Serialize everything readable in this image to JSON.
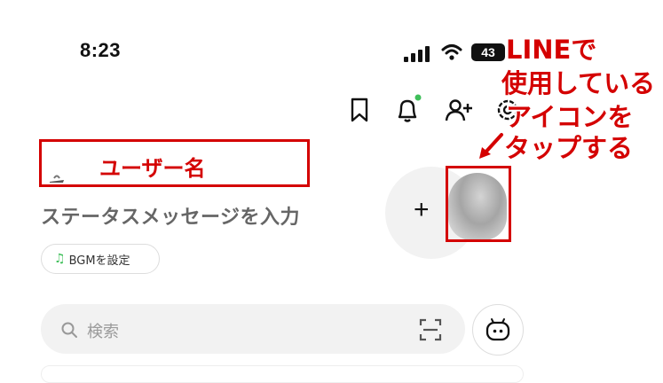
{
  "status_bar": {
    "time": "8:23",
    "battery": "43"
  },
  "header": {
    "icons": [
      "bookmark-icon",
      "bell-icon",
      "add-friend-icon",
      "settings-icon"
    ]
  },
  "profile": {
    "name_label": "ユーザー名",
    "status_placeholder": "ステータスメッセージを入力",
    "bgm_label": "BGMを設定",
    "add_symbol": "+"
  },
  "annotation": {
    "lines": [
      "LINEで",
      "使用している",
      "アイコンを",
      "タップする"
    ],
    "color": "#d40000"
  },
  "search": {
    "placeholder": "検索"
  },
  "colors": {
    "accent_green": "#3fbf5a",
    "annotation_red": "#d40000",
    "notification_dot": "#3fbf5a"
  }
}
